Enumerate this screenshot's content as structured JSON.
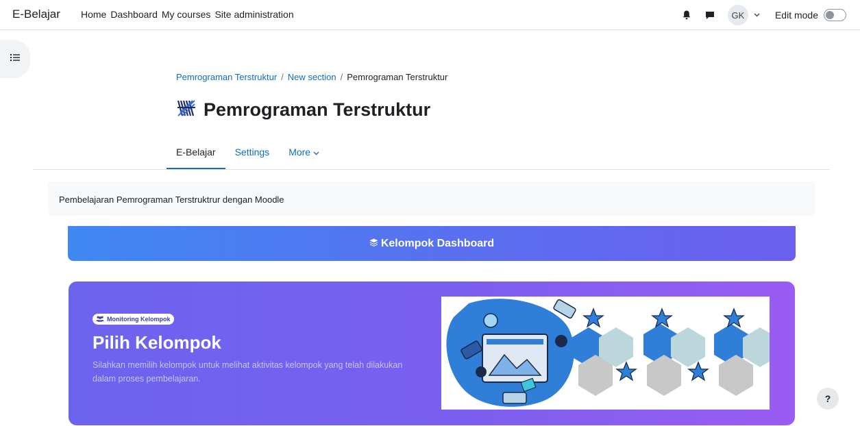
{
  "navbar": {
    "brand": "E-Belajar",
    "links": [
      "Home",
      "Dashboard",
      "My courses",
      "Site administration"
    ],
    "notification_icon": "bell-icon",
    "messages_icon": "chat-icon",
    "user_initials": "GK",
    "edit_mode_label": "Edit mode",
    "edit_mode_on": false
  },
  "breadcrumb": {
    "items": [
      "Pemrograman Terstruktur",
      "New section",
      "Pemrograman Terstruktur"
    ],
    "separator": "/"
  },
  "course": {
    "title": "Pemrograman Terstruktur"
  },
  "tabs": [
    {
      "label": "E-Belajar",
      "active": true
    },
    {
      "label": "Settings",
      "active": false
    },
    {
      "label": "More",
      "active": false
    }
  ],
  "summary": {
    "text": "Pembelajaran Pemrograman Terstruktrur dengan Moodle"
  },
  "kelompok_bar": {
    "label": "Kelompok Dashboard",
    "icon": "layers-icon"
  },
  "hero": {
    "badge": "Monitoring Kelompok",
    "title": "Pilih Kelompok",
    "description": "Silahkan memilih kelompok untuk melihat aktivitas kelompok yang telah dilakukan dalam proses pembelajaran."
  },
  "help": {
    "label": "?"
  },
  "colors": {
    "link": "#0f6cbf",
    "bar_start": "#3f88f2",
    "bar_end": "#6b5fef",
    "hero_start": "#6c63ee",
    "hero_end": "#9a5cf2"
  }
}
